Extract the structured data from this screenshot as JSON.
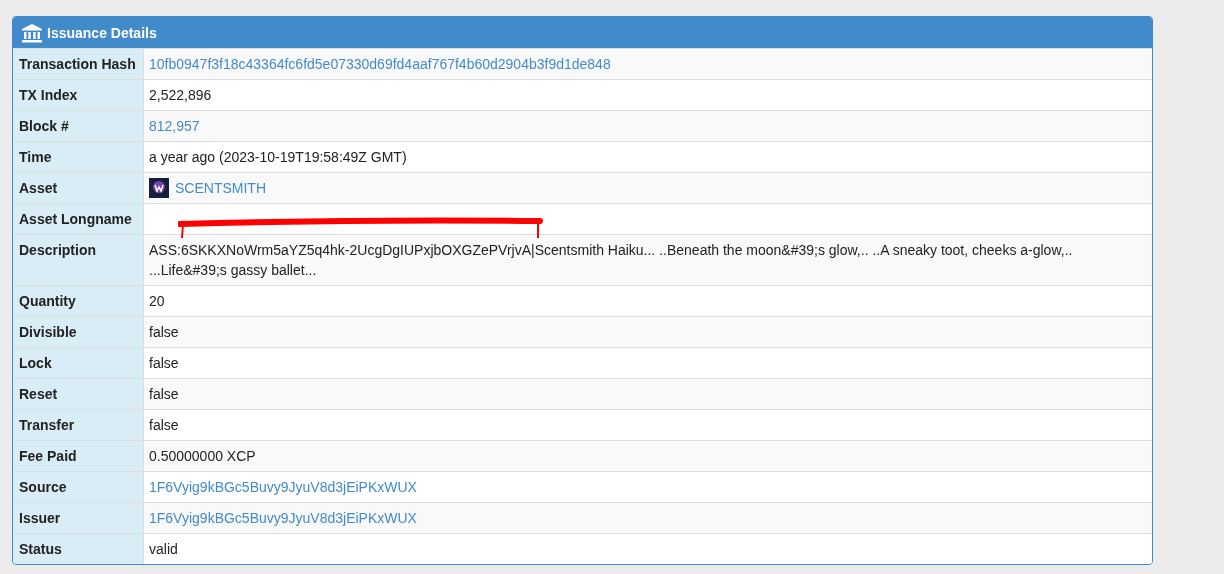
{
  "panel": {
    "title": "Issuance Details"
  },
  "rows": [
    {
      "label": "Transaction Hash",
      "kind": "link",
      "value": "10fb0947f3f18c43364fc6fd5e07330d69fd4aaf767f4b60d2904b3f9d1de848"
    },
    {
      "label": "TX Index",
      "kind": "text",
      "value": "2,522,896"
    },
    {
      "label": "Block #",
      "kind": "link",
      "value": "812,957"
    },
    {
      "label": "Time",
      "kind": "text",
      "value": "a year ago (2023-10-19T19:58:49Z GMT)"
    },
    {
      "label": "Asset",
      "kind": "asset",
      "value": "SCENTSMITH"
    },
    {
      "label": "Asset Longname",
      "kind": "empty"
    },
    {
      "label": "Description",
      "kind": "text",
      "value": "ASS:6SKKXNoWrm5aYZ5q4hk-2UcgDgIUPxjbOXGZePVrjvA|Scentsmith Haiku... ..Beneath the moon&#39;s glow,.. ..A sneaky toot, cheeks a-glow,.. ...Life&#39;s gassy ballet..."
    },
    {
      "label": "Quantity",
      "kind": "text",
      "value": "20"
    },
    {
      "label": "Divisible",
      "kind": "text",
      "value": "false"
    },
    {
      "label": "Lock",
      "kind": "text",
      "value": "false"
    },
    {
      "label": "Reset",
      "kind": "text",
      "value": "false"
    },
    {
      "label": "Transfer",
      "kind": "text",
      "value": "false"
    },
    {
      "label": "Fee Paid",
      "kind": "text",
      "value": "0.50000000 XCP"
    },
    {
      "label": "Source",
      "kind": "link",
      "value": "1F6Vyig9kBGc5Buvy9JyuV8d3jEiPKxWUX"
    },
    {
      "label": "Issuer",
      "kind": "link",
      "value": "1F6Vyig9kBGc5Buvy9JyuV8d3jEiPKxWUX"
    },
    {
      "label": "Status",
      "kind": "text",
      "value": "valid"
    }
  ]
}
